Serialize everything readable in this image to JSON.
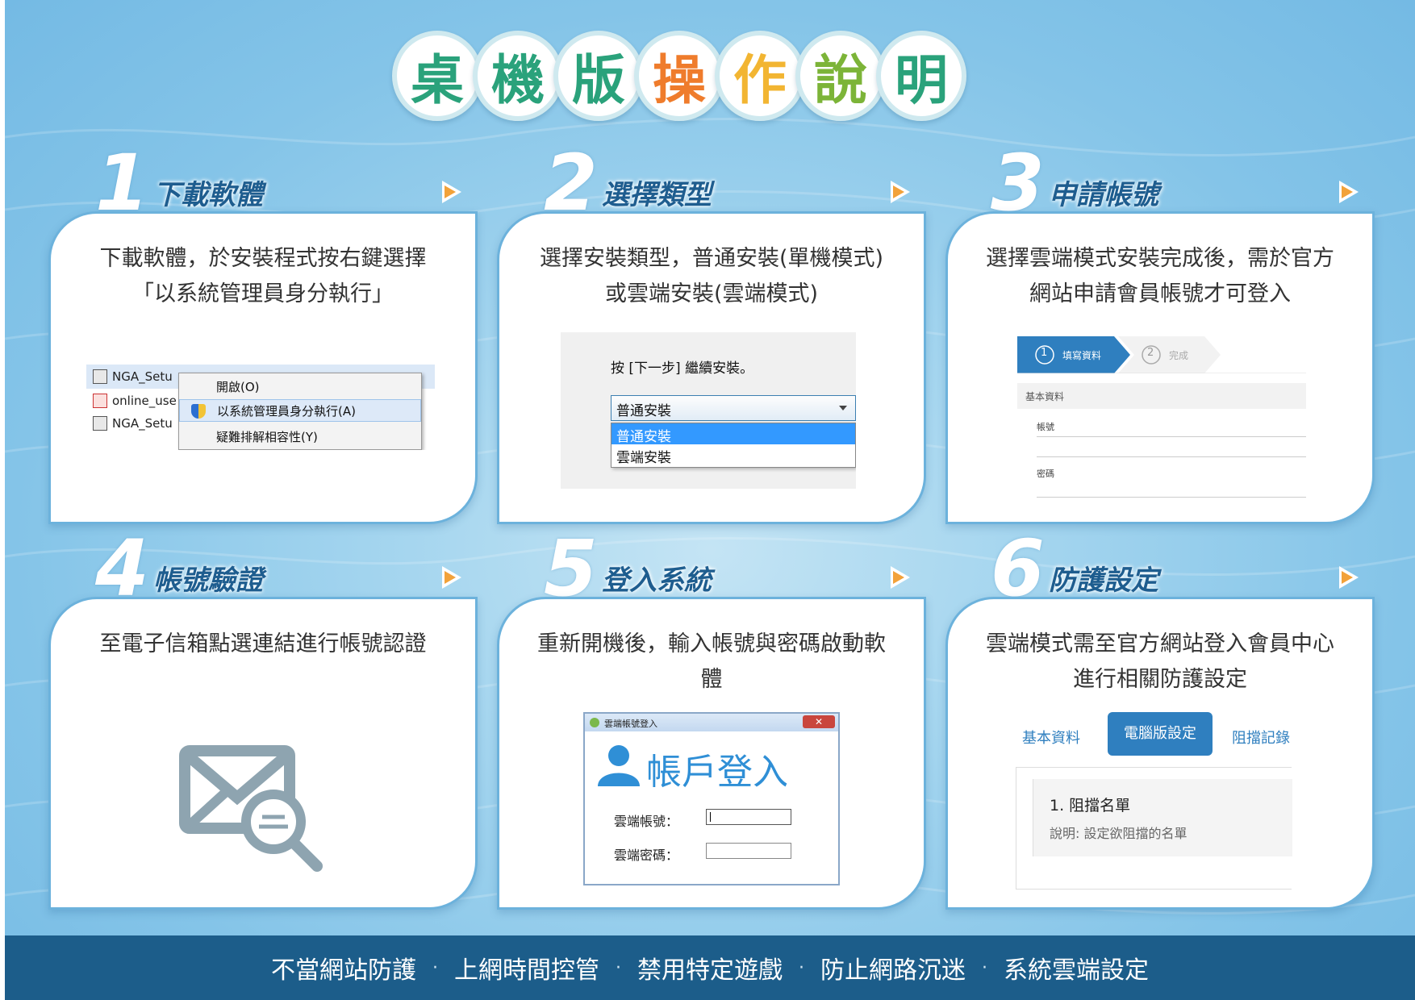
{
  "title_chars": [
    "桌",
    "機",
    "版",
    "操",
    "作",
    "說",
    "明"
  ],
  "title_colors": [
    "#2aa27b",
    "#2aa27b",
    "#2aa27b",
    "#ef7c2c",
    "#f2b532",
    "#7cb438",
    "#2aa27b"
  ],
  "steps": [
    {
      "num": "1",
      "title": "下載軟體",
      "desc": "下載軟體，於安裝程式按右鍵選擇「以系統管理員身分執行」"
    },
    {
      "num": "2",
      "title": "選擇類型",
      "desc": "選擇安裝類型，普通安裝(單機模式)或雲端安裝(雲端模式)"
    },
    {
      "num": "3",
      "title": "申請帳號",
      "desc": "選擇雲端模式安裝完成後，需於官方網站申請會員帳號才可登入"
    },
    {
      "num": "4",
      "title": "帳號驗證",
      "desc": "至電子信箱點選連結進行帳號認證"
    },
    {
      "num": "5",
      "title": "登入系統",
      "desc": "重新開機後，輸入帳號與密碼啟動軟體"
    },
    {
      "num": "6",
      "title": "防護設定",
      "desc": "雲端模式需至官方網站登入會員中心進行相關防護設定"
    }
  ],
  "shot1": {
    "files": [
      "NGA_Setu",
      "online_use",
      "NGA_Setu"
    ],
    "menu": [
      "開啟(O)",
      "以系統管理員身分執行(A)",
      "疑難排解相容性(Y)"
    ]
  },
  "shot2": {
    "prompt": "按 [下一步] 繼續安裝。",
    "selected": "普通安裝",
    "options": [
      "普通安裝",
      "雲端安裝"
    ]
  },
  "shot3": {
    "steps": [
      "填寫資料",
      "完成"
    ],
    "step_nums": [
      "1",
      "2"
    ],
    "section": "基本資料",
    "fields": [
      "帳號",
      "密碼"
    ]
  },
  "shot5": {
    "window_title": "雲端帳號登入",
    "heading": "帳戶登入",
    "account_label": "雲端帳號：",
    "password_label": "雲端密碼："
  },
  "shot6": {
    "tabs": [
      "基本資料",
      "電腦版設定",
      "阻擋記錄"
    ],
    "item_title": "1. 阻擋名單",
    "item_desc": "說明: 設定欲阻擋的名單"
  },
  "footer": [
    "不當網站防護",
    "上網時間控管",
    "禁用特定遊戲",
    "防止網路沉迷",
    "系統雲端設定"
  ],
  "footer_sep": "·"
}
